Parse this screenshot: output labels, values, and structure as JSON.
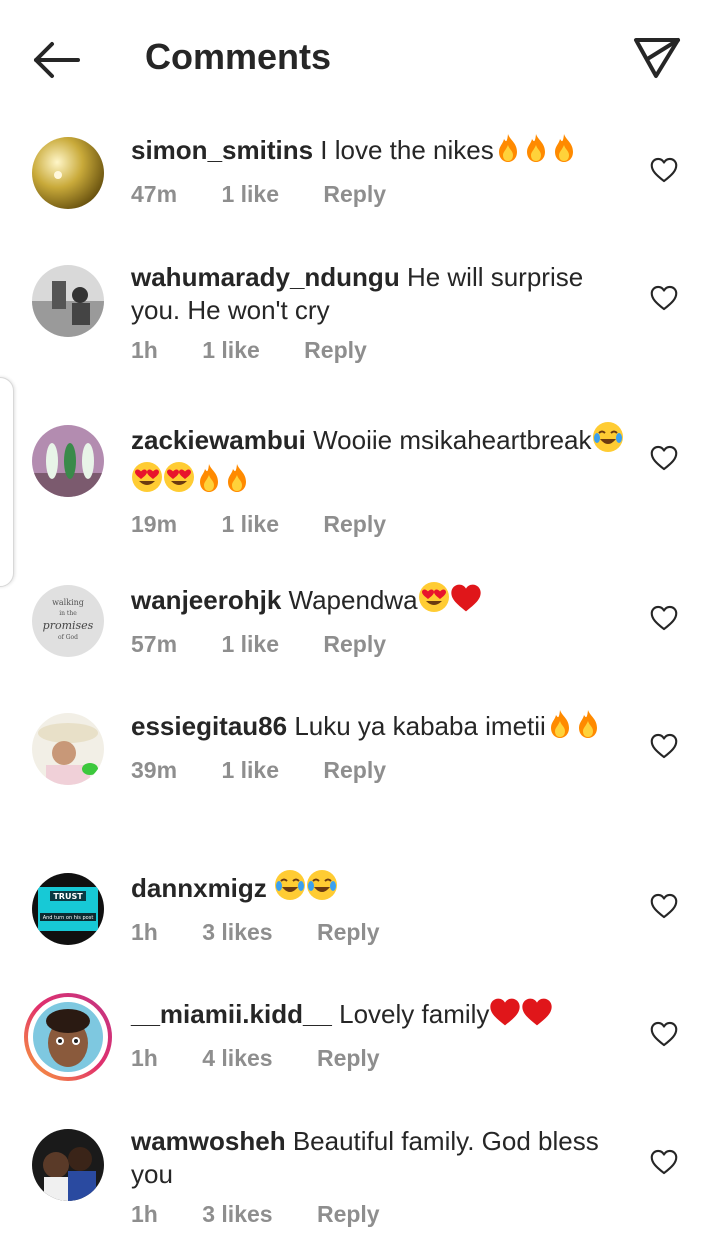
{
  "header": {
    "title": "Comments"
  },
  "colors": {
    "text": "#262626",
    "meta": "#8e8e8e",
    "fire": "#ff8a00",
    "heart_red": "#e0161a",
    "ring_start": "#f77737",
    "ring_end": "#c13584"
  },
  "comments": [
    {
      "username": "simon_smitins",
      "text": "I love the nikes",
      "emoji": [
        "fire",
        "fire",
        "fire"
      ],
      "time": "47m",
      "likes": "1 like",
      "reply": "Reply"
    },
    {
      "username": "wahumarady_ndungu",
      "text": "He will surprise you. He won't cry",
      "emoji": [],
      "time": "1h",
      "likes": "1 like",
      "reply": "Reply"
    },
    {
      "username": "zackiewambui",
      "text": "Wooiie msikaheartbreak",
      "emoji": [
        "joy",
        "heart-eyes",
        "heart-eyes",
        "fire",
        "fire"
      ],
      "time": "19m",
      "likes": "1 like",
      "reply": "Reply"
    },
    {
      "username": "wanjeerohjk",
      "text": "Wapendwa",
      "emoji": [
        "heart-eyes",
        "red-heart"
      ],
      "time": "57m",
      "likes": "1 like",
      "reply": "Reply",
      "avatar_text": [
        "walking",
        "in the",
        "promises",
        "of God"
      ]
    },
    {
      "username": "essiegitau86",
      "text": "Luku ya kababa imetii",
      "emoji": [
        "fire",
        "fire"
      ],
      "time": "39m",
      "likes": "1 like",
      "reply": "Reply"
    },
    {
      "username": "dannxmigz",
      "text": "",
      "emoji": [
        "joy",
        "joy"
      ],
      "time": "1h",
      "likes": "3 likes",
      "reply": "Reply",
      "avatar_text": [
        "TRUST",
        "And turn on his post"
      ]
    },
    {
      "username": "__miamii.kidd__",
      "text": "Lovely family",
      "emoji": [
        "red-heart",
        "red-heart"
      ],
      "time": "1h",
      "likes": "4 likes",
      "reply": "Reply"
    },
    {
      "username": "wamwosheh",
      "text": "Beautiful family. God bless you",
      "emoji": [],
      "time": "1h",
      "likes": "3 likes",
      "reply": "Reply"
    }
  ]
}
